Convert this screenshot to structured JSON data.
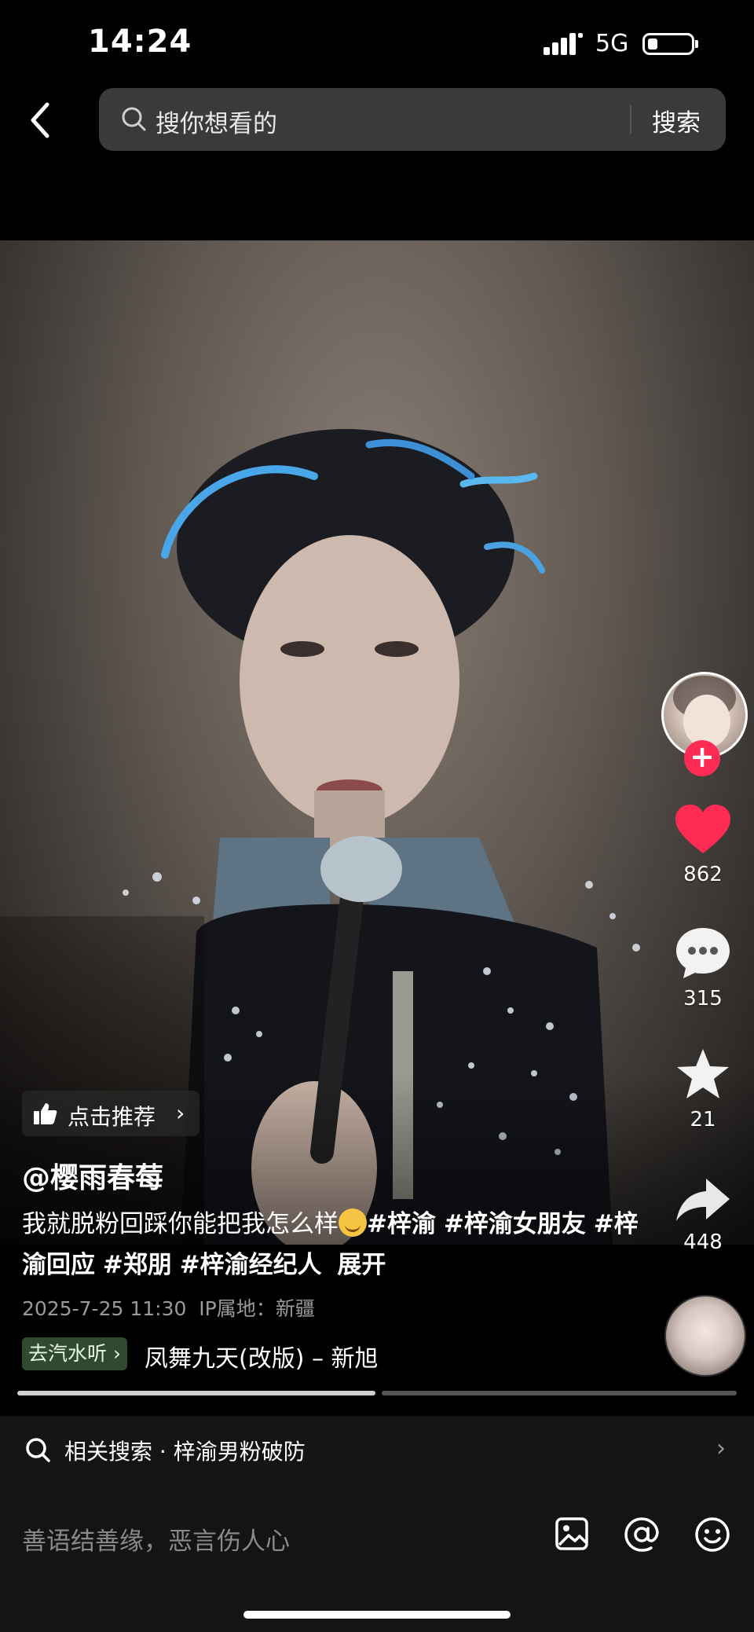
{
  "status": {
    "time": "14:24",
    "network": "5G"
  },
  "search": {
    "placeholder": "搜你想看的",
    "button": "搜索"
  },
  "actions": {
    "likes": "862",
    "comments": "315",
    "favorites": "21",
    "shares": "448"
  },
  "recommend": {
    "label": "点击推荐"
  },
  "post": {
    "author": "@樱雨春莓",
    "caption_text": "我就脱粉回踩你能把我怎么样",
    "tags": [
      "#梓渝",
      "#梓渝女朋友",
      "#梓渝回应",
      "#郑朋",
      "#梓渝经纪人"
    ],
    "expand": "展开",
    "date": "2025-7-25 11:30",
    "ip_location": "IP属地：新疆"
  },
  "music": {
    "chip": "去汽水听",
    "title": "凤舞九天(改版) – 新旭"
  },
  "related": {
    "label": "相关搜索 · 梓渝男粉破防"
  },
  "comment": {
    "placeholder": "善语结善缘，恶言伤人心"
  }
}
